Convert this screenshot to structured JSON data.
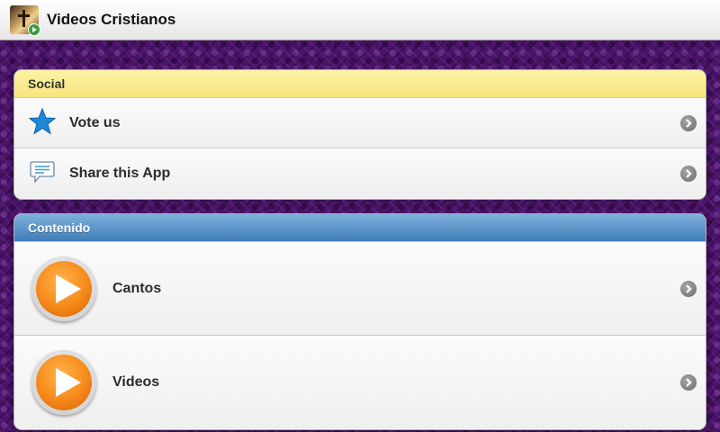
{
  "app": {
    "title": "Videos Cristianos"
  },
  "social": {
    "header": "Social",
    "items": [
      {
        "label": "Vote us",
        "icon": "star-icon"
      },
      {
        "label": "Share this App",
        "icon": "speech-bubble-icon"
      }
    ]
  },
  "contenido": {
    "header": "Contenido",
    "items": [
      {
        "label": "Cantos",
        "icon": "play-icon"
      },
      {
        "label": "Videos",
        "icon": "play-icon"
      }
    ]
  },
  "colors": {
    "background": "#4a1466",
    "social_header": "#f6e57c",
    "content_header": "#3e7db8",
    "play_orange": "#f58a1a",
    "star_blue": "#1e88d8"
  }
}
